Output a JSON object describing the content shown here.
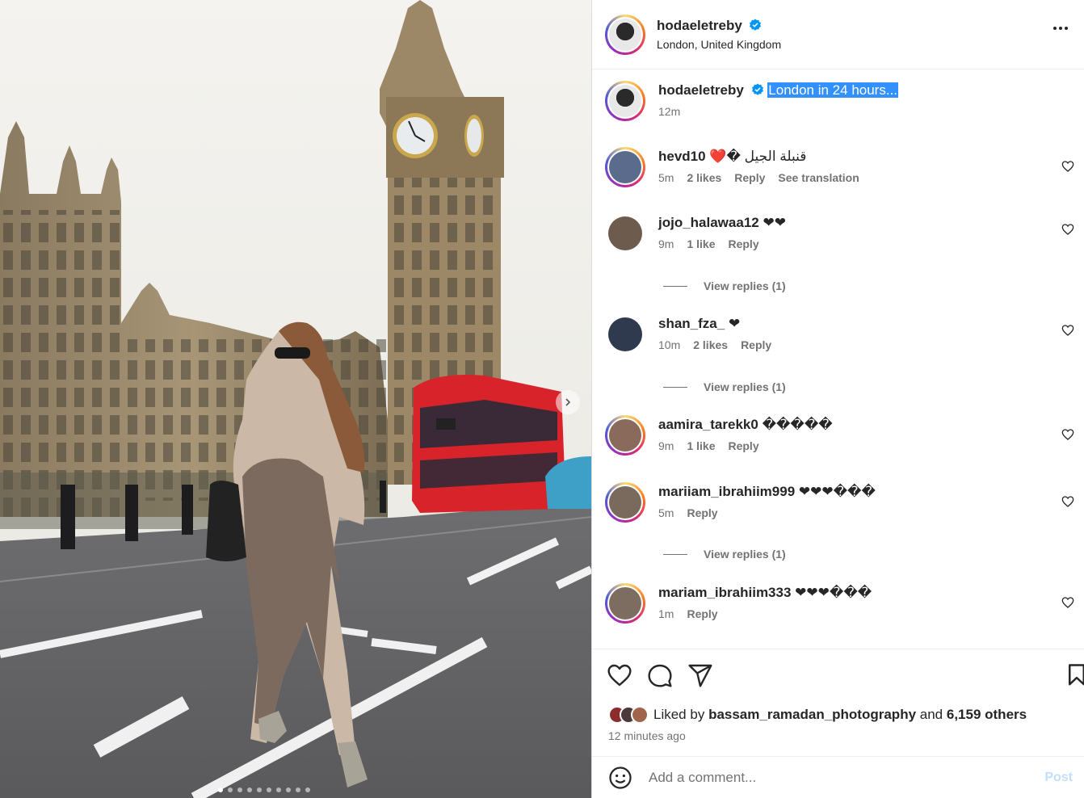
{
  "post": {
    "username": "hodaeletreby",
    "location": "London, United Kingdom",
    "caption": "London in 24 hours...",
    "caption_time": "12m",
    "carousel_dots": 10,
    "active_dot": 0
  },
  "comments": [
    {
      "username": "hevd10",
      "text": "❤️� قنبلة الجيل",
      "time": "5m",
      "likes": "2 likes",
      "reply": "Reply",
      "translate": "See translation",
      "ring": true,
      "avatar_color": "#5a6b8c"
    },
    {
      "username": "jojo_halawaa12",
      "text": "❤❤",
      "time": "9m",
      "likes": "1 like",
      "reply": "Reply",
      "ring": false,
      "avatar_color": "#6d5b4e",
      "view_replies": "View replies (1)"
    },
    {
      "username": "shan_fza_",
      "text": "❤",
      "time": "10m",
      "likes": "2 likes",
      "reply": "Reply",
      "ring": false,
      "avatar_color": "#2f3a4f",
      "view_replies": "View replies (1)"
    },
    {
      "username": "aamira_tarekk0",
      "text": "�����",
      "time": "9m",
      "likes": "1 like",
      "reply": "Reply",
      "ring": true,
      "avatar_color": "#8a6a5a"
    },
    {
      "username": "mariiam_ibrahiim999",
      "text": "❤❤❤���",
      "time": "5m",
      "reply": "Reply",
      "ring": true,
      "avatar_color": "#7a6a5e",
      "view_replies": "View replies (1)"
    },
    {
      "username": "mariam_ibrahiim333",
      "text": "❤❤❤���",
      "time": "1m",
      "reply": "Reply",
      "ring": true,
      "avatar_color": "#7d6c60"
    }
  ],
  "likes": {
    "prefix": "Liked by",
    "liker": "bassam_ramadan_photography",
    "and": "and",
    "others": "6,159 others",
    "time_ago": "12 minutes ago"
  },
  "add_comment": {
    "placeholder": "Add a comment...",
    "post_label": "Post"
  },
  "icons": {
    "like": "heart-icon",
    "comment": "comment-bubble-icon",
    "share": "paper-plane-icon",
    "save": "bookmark-icon",
    "emoji": "emoji-icon",
    "more": "more-dots-icon",
    "verified": "verified-badge-icon",
    "next": "chevron-right-icon"
  },
  "colors": {
    "verified": "#0095f6",
    "selection": "#3390ff",
    "post_disabled": "#c0dffd",
    "muted": "#737373"
  }
}
